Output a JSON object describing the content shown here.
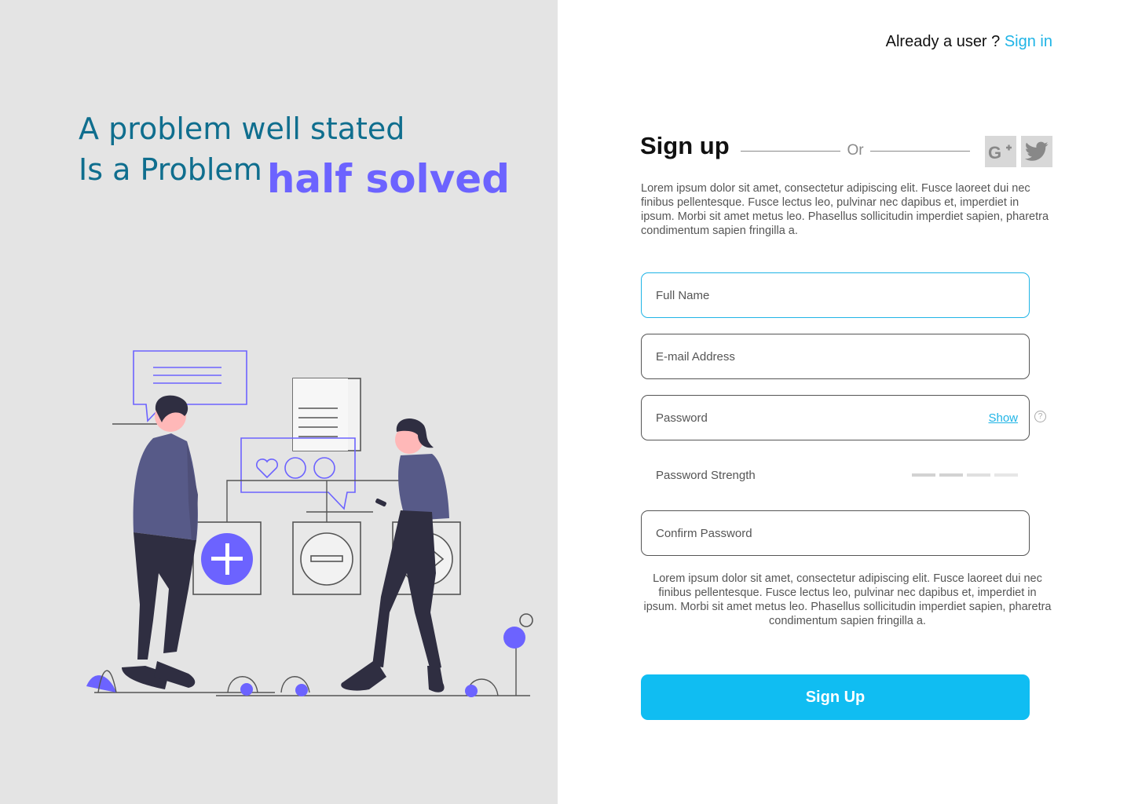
{
  "hero": {
    "line1": "A problem well stated",
    "line2": "Is a Problem",
    "accent": "half solved"
  },
  "header": {
    "already_user": "Already a user ?",
    "signin_link": "Sign in"
  },
  "form": {
    "title": "Sign up",
    "or_text": "Or",
    "social": [
      "google-plus-icon",
      "twitter-icon"
    ],
    "description_top": "Lorem ipsum dolor sit amet, consectetur adipiscing elit. Fusce laoreet dui nec finibus pellentesque. Fusce lectus leo, pulvinar nec dapibus et, imperdiet in ipsum. Morbi sit amet metus leo. Phasellus sollicitudin imperdiet sapien, pharetra condimentum sapien fringilla a.",
    "full_name_placeholder": "Full Name",
    "email_placeholder": "E-mail Address",
    "password_placeholder": "Password",
    "show_label": "Show",
    "help_glyph": "?",
    "strength_label": "Password Strength",
    "strength_level": 0,
    "confirm_placeholder": "Confirm Password",
    "description_bottom": "Lorem ipsum dolor sit amet, consectetur adipiscing elit. Fusce laoreet dui nec finibus pellentesque. Fusce lectus leo, pulvinar nec dapibus et, imperdiet in ipsum. Morbi sit amet metus leo. Phasellus sollicitudin imperdiet sapien, pharetra condimentum sapien fringilla a.",
    "submit_label": "Sign Up"
  },
  "colors": {
    "headline": "#0f6e8e",
    "accent": "#6c63ff",
    "link": "#1fb4e6",
    "button": "#10bdf2",
    "left_bg": "#e4e4e4"
  }
}
